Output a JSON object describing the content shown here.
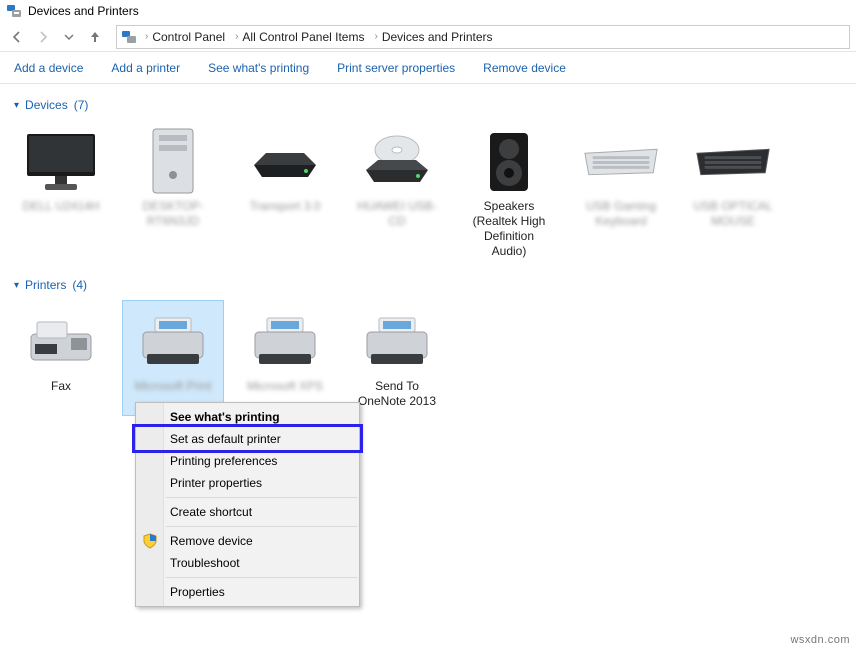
{
  "window": {
    "title": "Devices and Printers"
  },
  "breadcrumb": {
    "root_icon": "devices-printers",
    "items": [
      "Control Panel",
      "All Control Panel Items",
      "Devices and Printers"
    ]
  },
  "commands": {
    "add_device": "Add a device",
    "add_printer": "Add a printer",
    "see_printing": "See what's printing",
    "print_server": "Print server properties",
    "remove_device": "Remove device"
  },
  "groups": {
    "devices": {
      "label": "Devices",
      "count": "(7)"
    },
    "printers": {
      "label": "Printers",
      "count": "(4)"
    }
  },
  "devices": [
    {
      "icon": "monitor",
      "label": "DELL U2414H"
    },
    {
      "icon": "tower",
      "label": "DESKTOP-RT6N3JD"
    },
    {
      "icon": "drive",
      "label": "Transport 3.0"
    },
    {
      "icon": "disc",
      "label": "HUAWEI USB-CD"
    },
    {
      "icon": "speaker",
      "label": "Speakers (Realtek High Definition",
      "label2": "Audio)"
    },
    {
      "icon": "keyboard",
      "label": "USB Gaming Keyboard"
    },
    {
      "icon": "keyboard-dark",
      "label": "USB OPTICAL MOUSE"
    }
  ],
  "printers": [
    {
      "icon": "fax",
      "label": "Fax"
    },
    {
      "icon": "printer",
      "label": "Microsoft Print",
      "selected": true
    },
    {
      "icon": "printer",
      "label": "Microsoft XPS"
    },
    {
      "icon": "printer",
      "label": "Send To",
      "label2": "OneNote 2013"
    }
  ],
  "context_menu": {
    "see_printing": "See what's printing",
    "set_default": "Set as default printer",
    "printing_prefs": "Printing preferences",
    "printer_props": "Printer properties",
    "create_shortcut": "Create shortcut",
    "remove_device": "Remove device",
    "troubleshoot": "Troubleshoot",
    "properties": "Properties"
  },
  "watermark": "wsxdn.com"
}
